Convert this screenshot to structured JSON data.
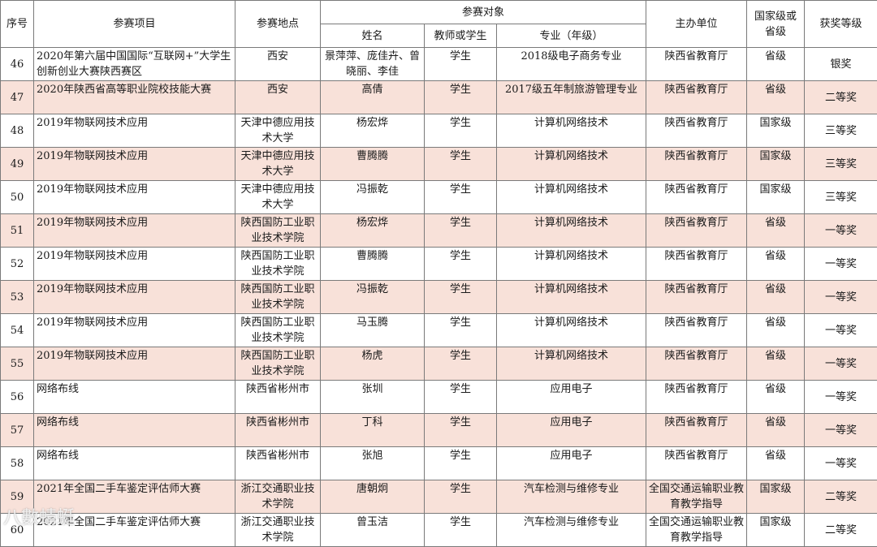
{
  "colors": {
    "row_alt": "#f8e1d9",
    "border": "#7a7a7a"
  },
  "headers": {
    "seq": "序号",
    "project": "参赛项目",
    "location": "参赛地点",
    "participants": "参赛对象",
    "name": "姓名",
    "role": "教师或学生",
    "major": "专业（年级）",
    "organizer": "主办单位",
    "level": "国家级或省级",
    "award": "获奖等级"
  },
  "rows": [
    {
      "seq": "46",
      "project": "2020年第六届中国国际“互联网+”大学生创新创业大赛陕西赛区",
      "location": "西安",
      "name": "景萍萍、庞佳卉、曾晓丽、李佳",
      "role": "学生",
      "major": "2018级电子商务专业",
      "organizer": "陕西省教育厅",
      "level": "省级",
      "award": "银奖"
    },
    {
      "seq": "47",
      "project": "2020年陕西省高等职业院校技能大赛",
      "location": "西安",
      "name": "高倩",
      "role": "学生",
      "major": "2017级五年制旅游管理专业",
      "organizer": "陕西省教育厅",
      "level": "省级",
      "award": "二等奖"
    },
    {
      "seq": "48",
      "project": "2019年物联网技术应用",
      "location": "天津中德应用技术大学",
      "name": "杨宏烨",
      "role": "学生",
      "major": "计算机网络技术",
      "organizer": "陕西省教育厅",
      "level": "国家级",
      "award": "三等奖"
    },
    {
      "seq": "49",
      "project": "2019年物联网技术应用",
      "location": "天津中德应用技术大学",
      "name": "曹腾腾",
      "role": "学生",
      "major": "计算机网络技术",
      "organizer": "陕西省教育厅",
      "level": "国家级",
      "award": "三等奖"
    },
    {
      "seq": "50",
      "project": "2019年物联网技术应用",
      "location": "天津中德应用技术大学",
      "name": "冯振乾",
      "role": "学生",
      "major": "计算机网络技术",
      "organizer": "陕西省教育厅",
      "level": "国家级",
      "award": "三等奖"
    },
    {
      "seq": "51",
      "project": "2019年物联网技术应用",
      "location": "陕西国防工业职业技术学院",
      "name": "杨宏烨",
      "role": "学生",
      "major": "计算机网络技术",
      "organizer": "陕西省教育厅",
      "level": "省级",
      "award": "一等奖"
    },
    {
      "seq": "52",
      "project": "2019年物联网技术应用",
      "location": "陕西国防工业职业技术学院",
      "name": "曹腾腾",
      "role": "学生",
      "major": "计算机网络技术",
      "organizer": "陕西省教育厅",
      "level": "省级",
      "award": "一等奖"
    },
    {
      "seq": "53",
      "project": "2019年物联网技术应用",
      "location": "陕西国防工业职业技术学院",
      "name": "冯振乾",
      "role": "学生",
      "major": "计算机网络技术",
      "organizer": "陕西省教育厅",
      "level": "省级",
      "award": "一等奖"
    },
    {
      "seq": "54",
      "project": "2019年物联网技术应用",
      "location": "陕西国防工业职业技术学院",
      "name": "马玉腾",
      "role": "学生",
      "major": "计算机网络技术",
      "organizer": "陕西省教育厅",
      "level": "省级",
      "award": "一等奖"
    },
    {
      "seq": "55",
      "project": "2019年物联网技术应用",
      "location": "陕西国防工业职业技术学院",
      "name": "杨虎",
      "role": "学生",
      "major": "计算机网络技术",
      "organizer": "陕西省教育厅",
      "level": "省级",
      "award": "一等奖"
    },
    {
      "seq": "56",
      "project": "网络布线",
      "location": "陕西省彬州市",
      "name": "张圳",
      "role": "学生",
      "major": "应用电子",
      "organizer": "陕西省教育厅",
      "level": "省级",
      "award": "一等奖"
    },
    {
      "seq": "57",
      "project": "网络布线",
      "location": "陕西省彬州市",
      "name": "丁科",
      "role": "学生",
      "major": "应用电子",
      "organizer": "陕西省教育厅",
      "level": "省级",
      "award": "一等奖"
    },
    {
      "seq": "58",
      "project": "网络布线",
      "location": "陕西省彬州市",
      "name": "张旭",
      "role": "学生",
      "major": "应用电子",
      "organizer": "陕西省教育厅",
      "level": "省级",
      "award": "一等奖"
    },
    {
      "seq": "59",
      "project": "2021年全国二手车鉴定评估师大赛",
      "location": "浙江交通职业技术学院",
      "name": "唐朝炯",
      "role": "学生",
      "major": "汽车检测与维修专业",
      "organizer": "全国交通运输职业教育教学指导",
      "level": "国家级",
      "award": "二等奖"
    },
    {
      "seq": "60",
      "project": "2021年全国二手车鉴定评估师大赛",
      "location": "浙江交通职业技术学院",
      "name": "曾玉洁",
      "role": "学生",
      "major": "汽车检测与维修专业",
      "organizer": "全国交通运输职业教育教学指导",
      "level": "国家级",
      "award": "二等奖"
    }
  ],
  "watermark": "八數蜻蜓"
}
